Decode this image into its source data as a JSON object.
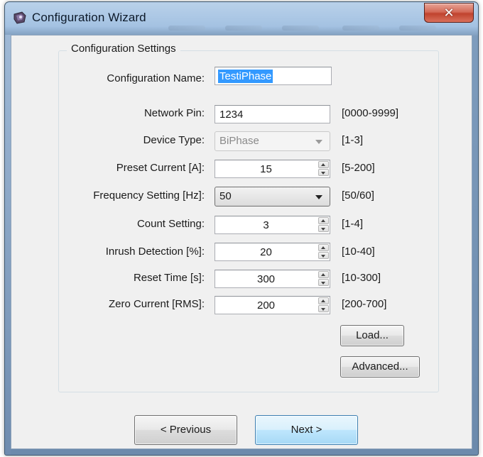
{
  "window": {
    "title": "Configuration Wizard",
    "close_symbol": "✕"
  },
  "group": {
    "legend": "Configuration Settings"
  },
  "form": {
    "config_name": {
      "label": "Configuration Name:",
      "value": "TestiPhase"
    },
    "network_pin": {
      "label": "Network Pin:",
      "value": "1234",
      "range": "[0000-9999]"
    },
    "device_type": {
      "label": "Device Type:",
      "value": "BiPhase",
      "range": "[1-3]"
    },
    "preset_current": {
      "label": "Preset Current [A]:",
      "value": "15",
      "range": "[5-200]"
    },
    "frequency": {
      "label": "Frequency Setting [Hz]:",
      "value": "50",
      "range": "[50/60]"
    },
    "count": {
      "label": "Count Setting:",
      "value": "3",
      "range": "[1-4]"
    },
    "inrush": {
      "label": "Inrush Detection [%]:",
      "value": "20",
      "range": "[10-40]"
    },
    "reset_time": {
      "label": "Reset Time [s]:",
      "value": "300",
      "range": "[10-300]"
    },
    "zero_current": {
      "label": "Zero Current [RMS]:",
      "value": "200",
      "range": "[200-700]"
    }
  },
  "buttons": {
    "load": "Load...",
    "advanced": "Advanced...",
    "previous": "< Previous",
    "next": "Next >"
  },
  "icons": {
    "app": "app-icon",
    "close": "close-icon",
    "spin_up": "chevron-up-icon",
    "spin_down": "chevron-down-icon",
    "dropdown": "dropdown-arrow-icon"
  },
  "colors": {
    "selection": "#3399ff",
    "close_button": "#c0432e",
    "next_button": "#bee6fd"
  }
}
